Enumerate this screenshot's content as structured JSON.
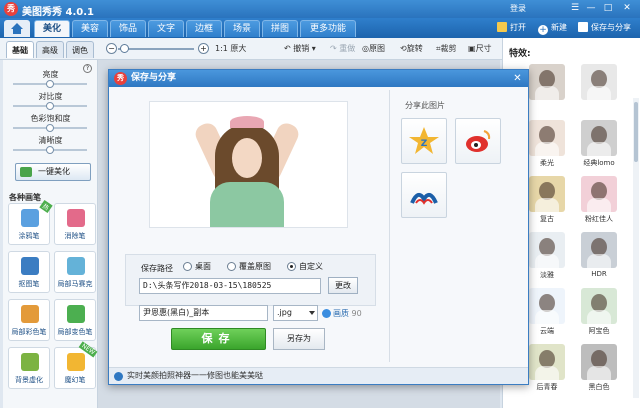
{
  "app": {
    "title": "美图秀秀 4.0.1",
    "logo_char": "秀",
    "login": "登录"
  },
  "window_controls": [
    "☰",
    "—",
    "□",
    "✕"
  ],
  "tabs": [
    "美化",
    "美容",
    "饰品",
    "文字",
    "边框",
    "场景",
    "拼图",
    "更多功能 ▾"
  ],
  "top_actions": {
    "open": "打开",
    "new": "新建",
    "save_share": "保存与分享"
  },
  "subtabs": [
    "基础",
    "高级",
    "调色"
  ],
  "toolbar": {
    "zoom_minus": "−",
    "zoom_plus": "+",
    "original_size": "1:1 原大",
    "undo": "撤销",
    "redo": "重做",
    "original_image": "原图",
    "rotate": "旋转",
    "crop": "裁剪",
    "resize": "尺寸"
  },
  "adjustments": [
    {
      "label": "亮度",
      "level": 0.5
    },
    {
      "label": "对比度",
      "level": 0.5
    },
    {
      "label": "色彩饱和度",
      "level": 0.5
    },
    {
      "label": "清晰度",
      "level": 0.5
    }
  ],
  "beautify_button": "一键美化",
  "brush_section_title": "各种画笔",
  "brushes": [
    {
      "label": "涂鸦笔",
      "color": "#5aa0e0",
      "badge": "热"
    },
    {
      "label": "消除笔",
      "color": "#e36a8a",
      "badge": ""
    },
    {
      "label": "抠图笔",
      "color": "#3b7dc2",
      "badge": ""
    },
    {
      "label": "局部马赛克",
      "color": "#64b2d8",
      "badge": ""
    },
    {
      "label": "局部彩色笔",
      "color": "#e39a3a",
      "badge": ""
    },
    {
      "label": "局部变色笔",
      "color": "#4caf50",
      "badge": ""
    },
    {
      "label": "背景虚化",
      "color": "#7cb342",
      "badge": ""
    },
    {
      "label": "魔幻笔",
      "color": "#f2b632",
      "badge": "NEW"
    }
  ],
  "effects_panel": {
    "title": "特效:",
    "items": [
      {
        "label": "",
        "color": "#d9d2cb"
      },
      {
        "label": "",
        "color": "#e8e8e8"
      },
      {
        "label": "柔光",
        "color": "#efe3da"
      },
      {
        "label": "经典lomo",
        "color": "#cfcfcf"
      },
      {
        "label": "复古",
        "color": "#e7d7a8"
      },
      {
        "label": "粉红佳人",
        "color": "#f2d0d8"
      },
      {
        "label": "淡雅",
        "color": "#e9eef2"
      },
      {
        "label": "HDR",
        "color": "#c9cfd6"
      },
      {
        "label": "云端",
        "color": "#eef4fb"
      },
      {
        "label": "阿宝色",
        "color": "#d8e8d6"
      },
      {
        "label": "后青春",
        "color": "#e0e4c8"
      },
      {
        "label": "黑白色",
        "color": "#bdbdbd"
      }
    ]
  },
  "dialog": {
    "title": "保存与分享",
    "share_title": "分享此图片",
    "share_targets": [
      {
        "name": "qzone",
        "color": "#f2b632"
      },
      {
        "name": "weibo",
        "color": "#e0312d"
      },
      {
        "name": "renren",
        "color": "#1c5fa8"
      }
    ],
    "save_path_label": "保存路径",
    "radio_options": [
      {
        "label": "桌面",
        "checked": false
      },
      {
        "label": "覆盖原图",
        "checked": false
      },
      {
        "label": "自定义",
        "checked": true
      }
    ],
    "path_value": "D:\\头条写作2018-03-15\\180525",
    "change_button": "更改",
    "filename_value": "尹恩惠(黑白)_副本",
    "format_value": ".jpg",
    "quality_label": "画质",
    "quality_value": "90",
    "save_button": "保存",
    "save_as_button": "另存为",
    "status_text": "实时美颜拍照神器一一修图也能美美哒"
  }
}
